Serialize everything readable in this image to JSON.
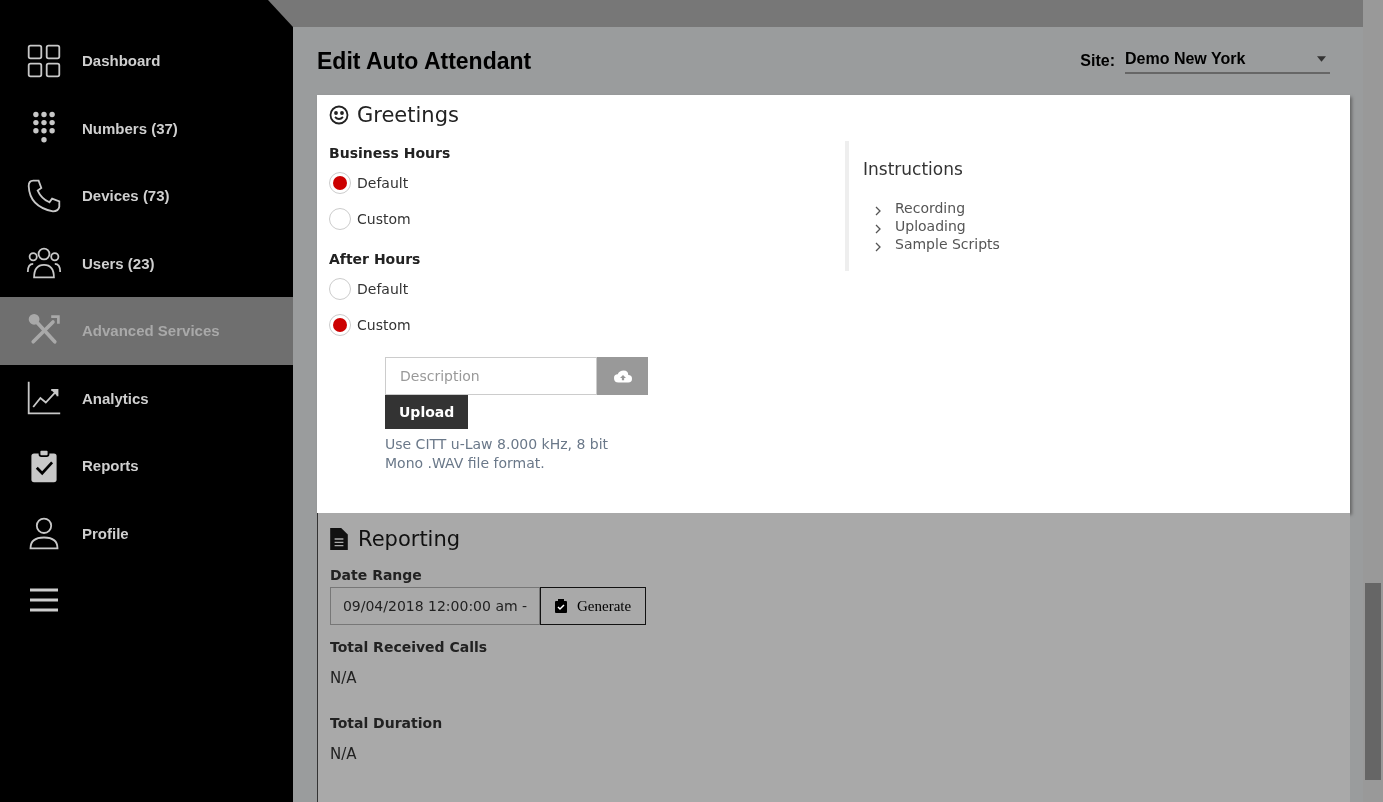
{
  "sidebar": {
    "items": [
      {
        "label": "Dashboard",
        "selected": false
      },
      {
        "label": "Numbers (37)",
        "selected": false
      },
      {
        "label": "Devices (73)",
        "selected": false
      },
      {
        "label": "Users (23)",
        "selected": false
      },
      {
        "label": "Advanced Services",
        "selected": true
      },
      {
        "label": "Analytics",
        "selected": false
      },
      {
        "label": "Reports",
        "selected": false
      },
      {
        "label": "Profile",
        "selected": false
      }
    ]
  },
  "header": {
    "title": "Edit Auto Attendant",
    "site_label": "Site:",
    "site_value": "Demo New York"
  },
  "greetings": {
    "title": "Greetings",
    "groups": [
      {
        "label": "Business Hours",
        "options": [
          {
            "label": "Default",
            "selected": true
          },
          {
            "label": "Custom",
            "selected": false
          }
        ]
      },
      {
        "label": "After Hours",
        "options": [
          {
            "label": "Default",
            "selected": false
          },
          {
            "label": "Custom",
            "selected": true
          }
        ]
      }
    ],
    "upload": {
      "placeholder": "Description",
      "button": "Upload",
      "note": "Use CITT u-Law 8.000 kHz, 8 bit Mono .WAV file format."
    },
    "instructions": {
      "title": "Instructions",
      "items": [
        "Recording",
        "Uploading",
        "Sample Scripts"
      ]
    }
  },
  "reporting": {
    "title": "Reporting",
    "date_range_label": "Date Range",
    "date_value": "09/04/2018 12:00:00 am -",
    "generate_button": "Generate",
    "stats": [
      {
        "label": "Total Received Calls",
        "value": "N/A"
      },
      {
        "label": "Total Duration",
        "value": "N/A"
      }
    ]
  }
}
